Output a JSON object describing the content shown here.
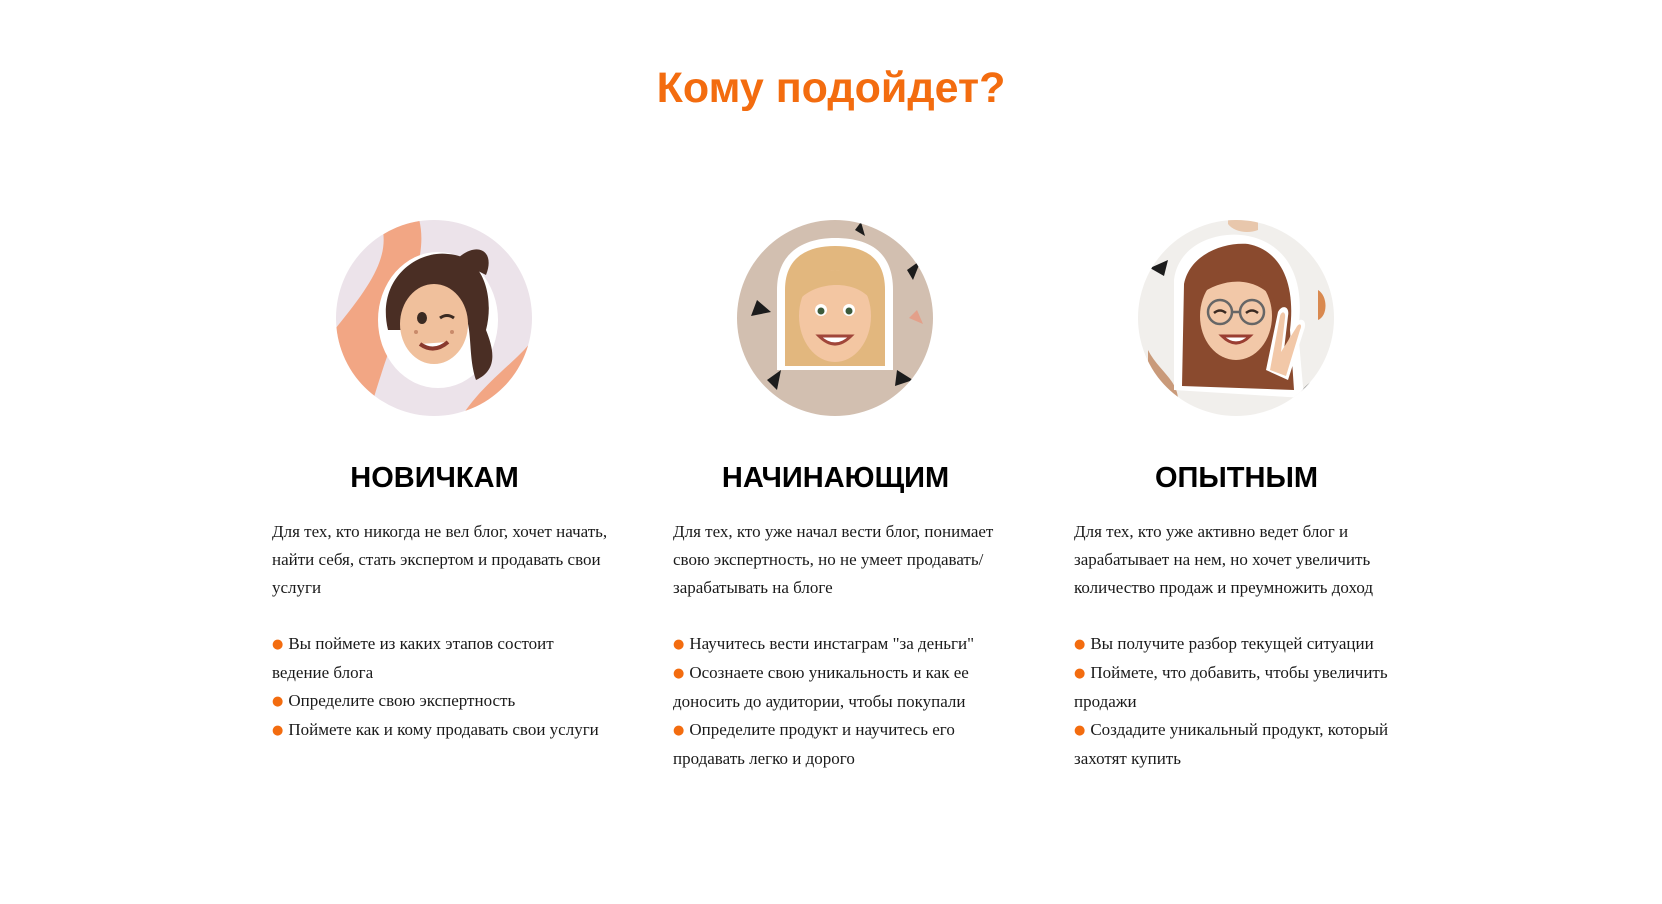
{
  "title": "Кому подойдет?",
  "colors": {
    "accent": "#f36c0f",
    "text": "#1a1a1a",
    "heading": "#000000",
    "background": "#ffffff"
  },
  "columns": [
    {
      "avatar_icon": "memoji-winking-girl-dark-hair",
      "heading": "НОВИЧКАМ",
      "description": "Для тех, кто никогда не вел блог, хочет начать, найти себя, стать экспертом и продавать свои услуги",
      "bullets": [
        "Вы поймете из каких этапов состоит ведение блога",
        "Определите свою экспертность",
        "Поймете как и кому продавать свои услуги"
      ]
    },
    {
      "avatar_icon": "memoji-smiling-girl-blonde-hair",
      "heading": "НАЧИНАЮЩИМ",
      "description": "Для тех, кто уже начал вести блог, понимает свою экспертность, но не умеет продавать/зарабатывать на блоге",
      "bullets": [
        "Научитесь вести инстаграм \"за деньги\"",
        "Осознаете свою уникальность и как ее доносить до аудитории, чтобы покупали",
        "Определите продукт и научитесь его продавать легко и дорого"
      ]
    },
    {
      "avatar_icon": "memoji-girl-with-glasses",
      "heading": "ОПЫТНЫМ",
      "description": "Для тех, кто уже активно ведет блог и зарабатывает на нем, но хочет увеличить количество продаж и преумножить доход",
      "bullets": [
        "Вы получите разбор текущей ситуации",
        "Поймете, что добавить, чтобы увеличить продажи",
        "Создадите уникальный продукт, который захотят купить"
      ]
    }
  ]
}
